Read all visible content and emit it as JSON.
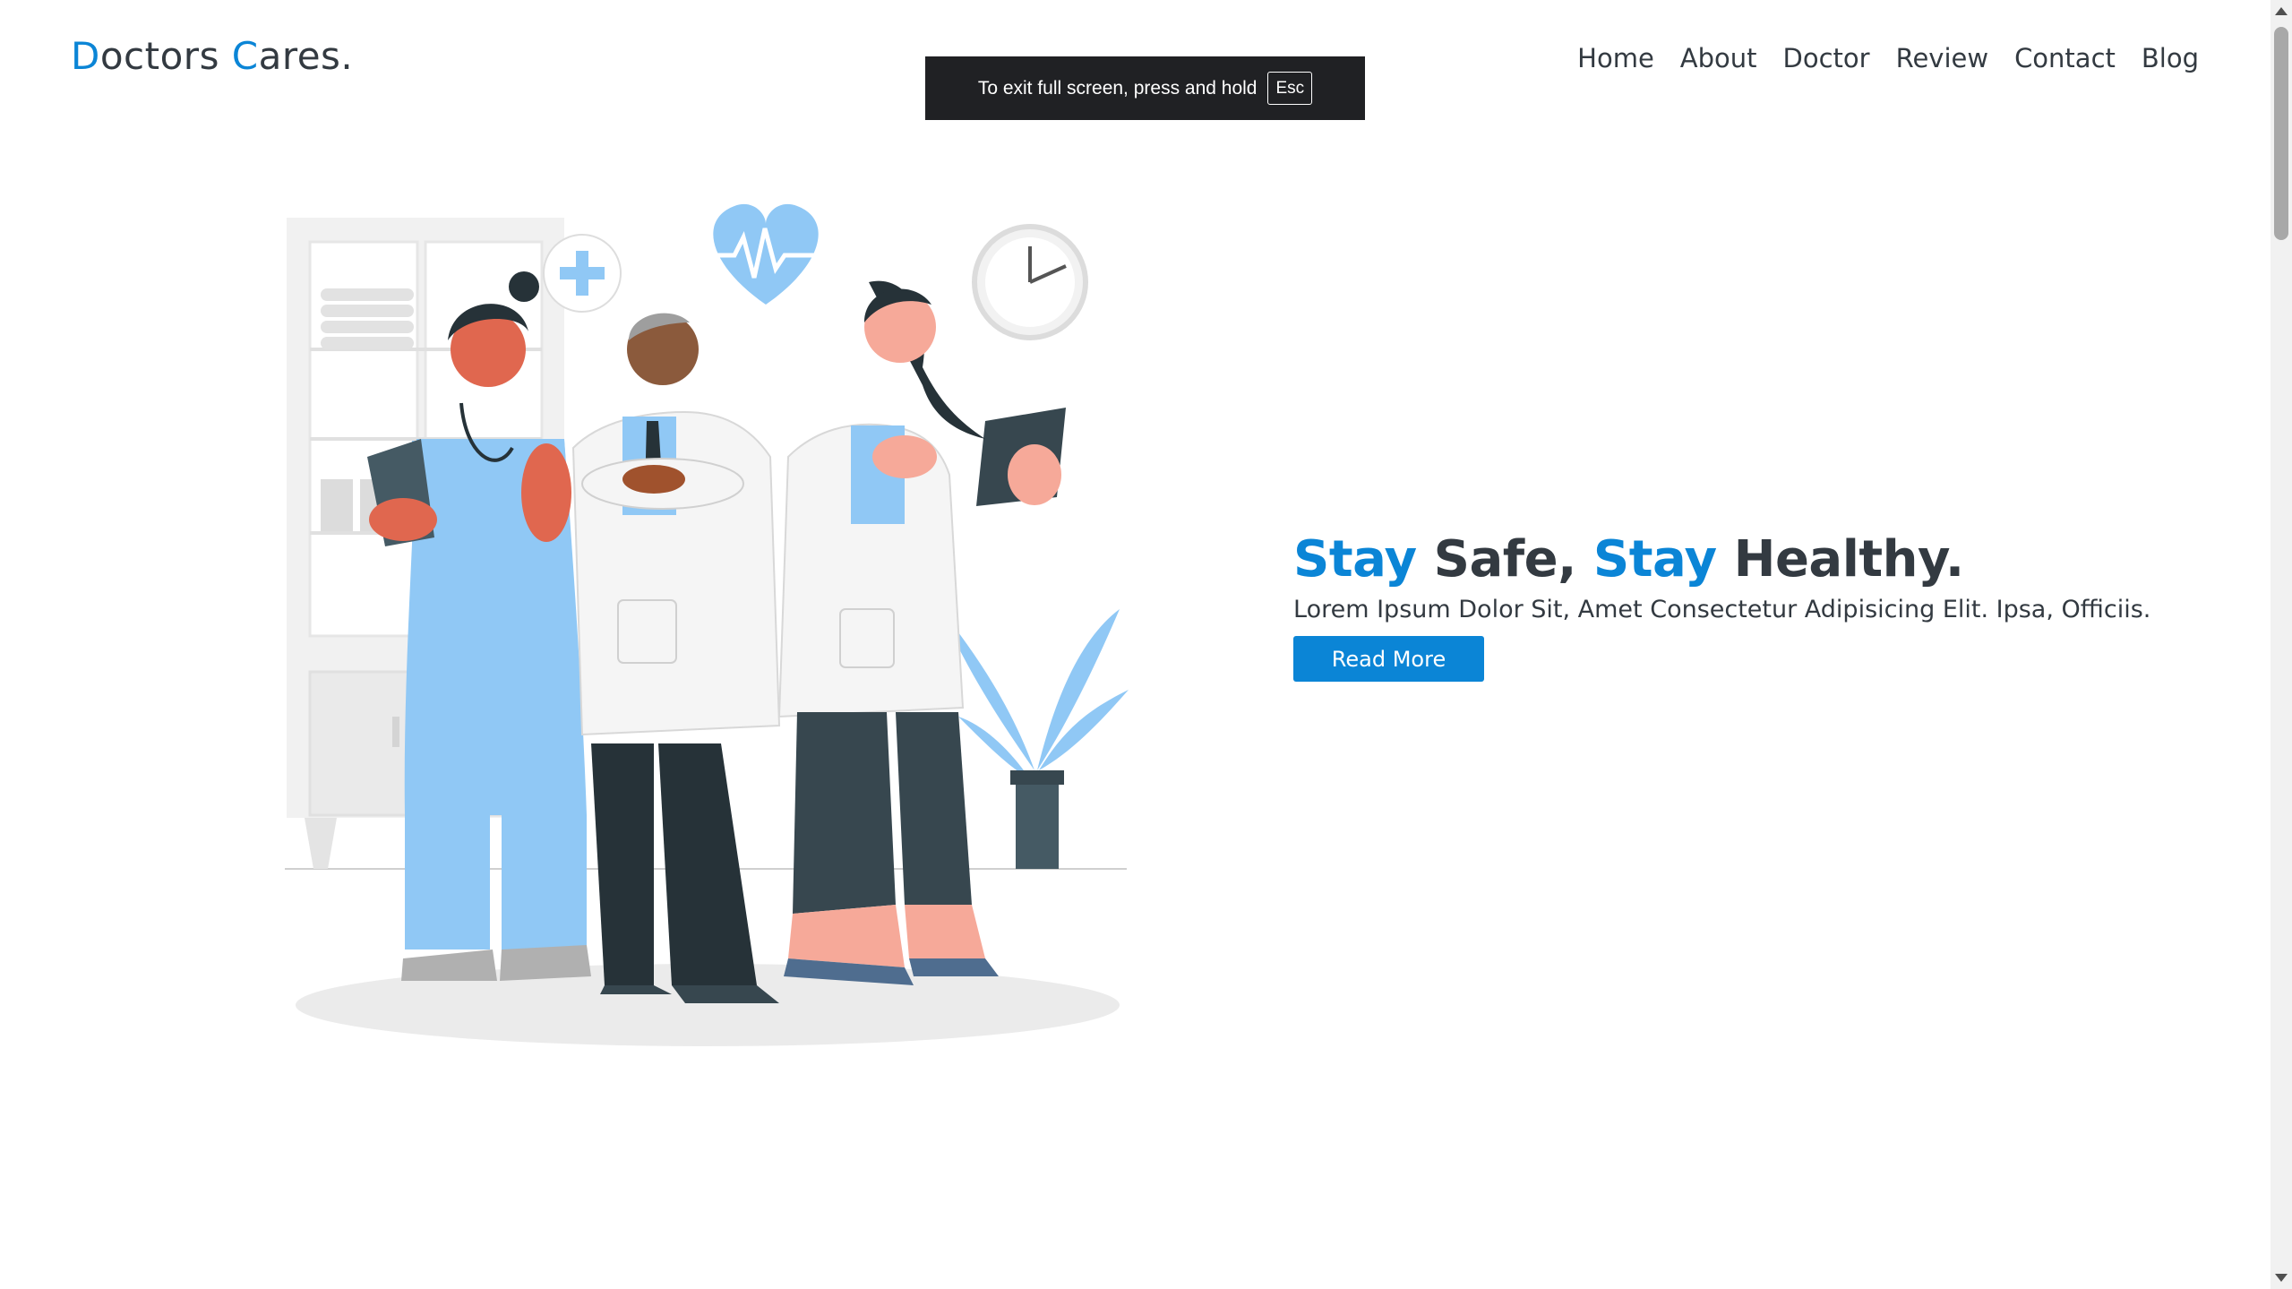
{
  "logo": {
    "first_initial": "D",
    "first_rest": "octors ",
    "second_initial": "C",
    "second_rest": "ares."
  },
  "nav": {
    "items": [
      {
        "label": "Home"
      },
      {
        "label": "About"
      },
      {
        "label": "Doctor"
      },
      {
        "label": "Review"
      },
      {
        "label": "Contact"
      },
      {
        "label": "Blog"
      }
    ]
  },
  "fullscreen_toast": {
    "message": "To exit full screen, press and hold",
    "key": "Esc"
  },
  "hero": {
    "title_part1": "Stay",
    "title_part2": " Safe, ",
    "title_part3": "Stay",
    "title_part4": " Healthy.",
    "subtitle": "Lorem Ipsum Dolor Sit, Amet Consectetur Adipisicing Elit. Ipsa, Officiis.",
    "button_label": "Read More"
  },
  "colors": {
    "accent": "#0b85d6",
    "text_dark": "#333a41",
    "toast_bg": "#202124"
  }
}
